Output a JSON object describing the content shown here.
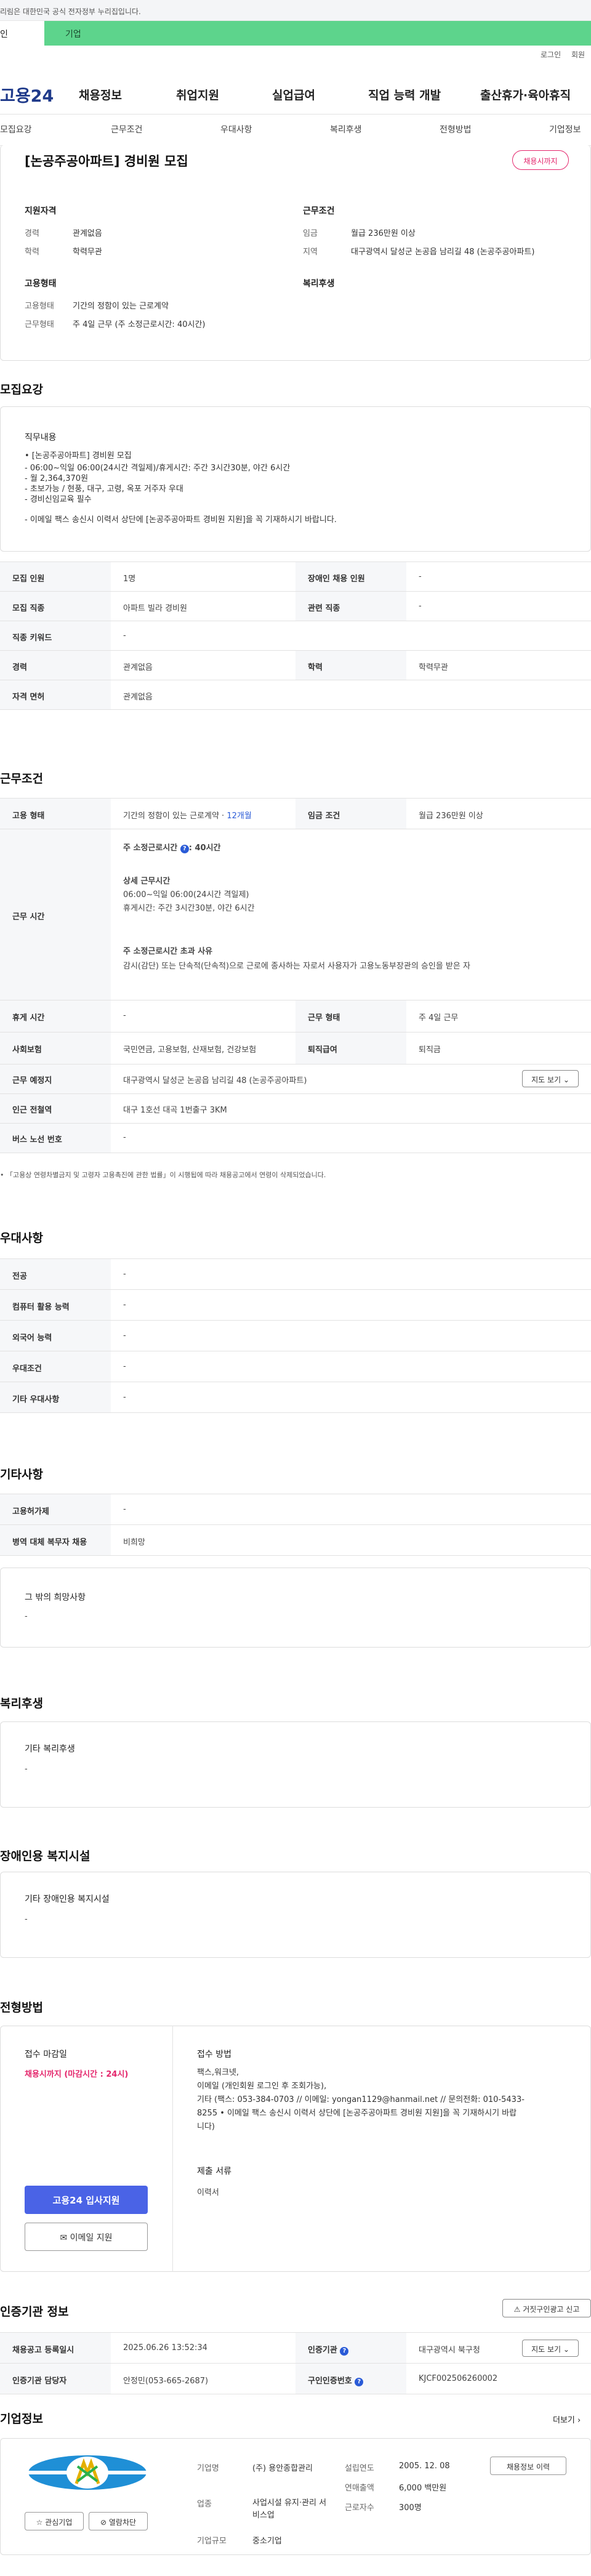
{
  "topnote": "리림은 대한민국 공식 전자정부 누리집입니다.",
  "tabs": {
    "individual": "인",
    "company": "기업"
  },
  "util": {
    "login": "로그인",
    "join": "회원"
  },
  "logo": "고용24",
  "gnb": [
    "채용정보",
    "취업지원",
    "실업급여",
    "직업 능력 개발",
    "출산휴가·육아휴직"
  ],
  "subnav": [
    "모집요강",
    "근무조건",
    "우대사항",
    "복리후생",
    "전형방법",
    "기업정보"
  ],
  "job_title": "[논공주공아파트] 경비원 모집",
  "status_pill": "채용시까지",
  "summary": {
    "qual_title": "지원자격",
    "qual": [
      {
        "k": "경력",
        "v": "관계없음"
      },
      {
        "k": "학력",
        "v": "학력무관"
      }
    ],
    "cond_title": "근무조건",
    "cond": [
      {
        "k": "임금",
        "v": "월급 236만원 이상"
      },
      {
        "k": "지역",
        "v": "대구광역시 달성군 논공읍 남리길 48 (논공주공아파트)"
      }
    ],
    "emp_title": "고용형태",
    "emp": [
      {
        "k": "고용형태",
        "v": "기간의 정함이 있는 근로계약"
      },
      {
        "k": "근무형태",
        "v": "주 4일 근무 (주 소정근로시간: 40시간)"
      }
    ],
    "welfare_title": "복리후생"
  },
  "recruit": {
    "section": "모집요강",
    "duty_title": "직무내용",
    "duty_lines": [
      "• [논공주공아파트] 경비원 모집",
      "- 06:00~익일 06:00(24시간 격일제)/휴게시간: 주간 3시간30분, 야간 6시간",
      "- 월 2,364,370원",
      "- 초보가능 / 현풍, 대구, 고령, 옥포 거주자 우대",
      "- 경비신임교육 필수",
      "",
      "- 이메일 팩스 송신시 이력서 상단에 [논공주공아파트 경비원 지원]을 꼭 기재하시기 바랍니다."
    ],
    "rows": [
      {
        "k1": "모집 인원",
        "v1": "1명",
        "k2": "장애인 채용 인원",
        "v2": "-"
      },
      {
        "k1": "모집 직종",
        "v1": "아파트 빌라 경비원",
        "k2": "관련 직종",
        "v2": "-"
      },
      {
        "k1": "직종 키워드",
        "v1": "-",
        "k2": "",
        "v2": ""
      },
      {
        "k1": "경력",
        "v1": "관계없음",
        "k2": "학력",
        "v2": "학력무관"
      },
      {
        "k1": "자격 면허",
        "v1": "관계없음",
        "k2": "",
        "v2": ""
      }
    ]
  },
  "work": {
    "section": "근무조건",
    "type_k": "고용 형태",
    "type_v": "기간의 정함이 있는 근로계약",
    "type_months": "12개월",
    "wage_k": "임금 조건",
    "wage_v": "월급 236만원 이상",
    "time_k": "근무 시간",
    "weekly": "주 소정근로시간",
    "weekly_v": ": 40시간",
    "detail_title": "상세 근무시간",
    "detail1": "06:00~익일 06:00(24시간 격일제)",
    "detail2": "휴게시간: 주간 3시간30분, 야간 6시간",
    "over_title": "주 소정근로시간 초과 사유",
    "over_text": "감시(감단) 또는 단속적(단속적)으로 근로에 종사하는 자로서 사용자가 고용노동부장관의 승인을 받은 자",
    "rest_k": "휴게 시간",
    "rest_v": "-",
    "form_k": "근무 형태",
    "form_v": "주 4일 근무",
    "ins_k": "사회보험",
    "ins_v": "국민연금, 고용보험, 산재보험, 건강보험",
    "sev_k": "퇴직급여",
    "sev_v": "퇴직금",
    "place_k": "근무 예정지",
    "place_v": "대구광역시 달성군 논공읍 남리길 48 (논공주공아파트)",
    "map_btn": "지도 보기",
    "sub_k": "인근 전철역",
    "sub_v": "대구 1호선 대곡 1번출구 3KM",
    "bus_k": "버스 노선 번호",
    "bus_v": "-",
    "note": "• 「고용상 연령차별금지 및 고령자 고용촉진에 관한 법률」이 시행됩에 따라 채용공고에서 연령이 삭제되었습니다."
  },
  "pref": {
    "section": "우대사항",
    "rows": [
      {
        "k": "전공",
        "v": "-"
      },
      {
        "k": "컴퓨터 활용 능력",
        "v": "-"
      },
      {
        "k": "외국어 능력",
        "v": "-"
      },
      {
        "k": "우대조건",
        "v": "-"
      },
      {
        "k": "기타 우대사항",
        "v": "-"
      }
    ]
  },
  "etc": {
    "section": "기타사항",
    "rows": [
      {
        "k": "고용허가제",
        "v": "-"
      },
      {
        "k": "병역 대체 복무자 채용",
        "v": "비희망"
      }
    ],
    "other_title": "그 밖의 희망사항",
    "other_v": "-"
  },
  "welfare": {
    "section": "복리후생",
    "title": "기타 복리후생",
    "v": "-"
  },
  "disabled": {
    "section": "장애인용 복지시설",
    "title": "기타 장애인용 복지시설",
    "v": "-"
  },
  "apply": {
    "section": "전형방법",
    "deadline_title": "접수 마감일",
    "deadline_v": "채용시까지 (마감시간 : 24시)",
    "method_title": "접수 방법",
    "methods": [
      "팩스,워크넷,",
      "이메일 (개인회원 로그인 후 조회가능),",
      "기타 (팩스: 053-384-0703 // 이메일: yongan1129@hanmail.net // 문의전화: 010-5433-",
      "8255 • 이메일 팩스 송신시 이력서 상단에 [논공주공아파트 경비원 지원]을 꼭 기재하시기 바랍",
      "니다)"
    ],
    "docs_title": "제출 서류",
    "docs_v": "이력서",
    "apply_btn": "고용24 입사지원",
    "email_btn": "이메일 지원"
  },
  "cert": {
    "section": "인증기관 정보",
    "report_btn": "거짓구인광고 신고",
    "reg_k": "채용공고 등록일시",
    "reg_v": "2025.06.26 13:52:34",
    "org_k": "인증기관",
    "org_v": "대구광역시 북구청",
    "map_btn": "지도 보기",
    "mgr_k": "인증기관 담당자",
    "mgr_v": "안정민(053-665-2687)",
    "num_k": "구인인증번호",
    "num_v": "KJCF002506260002"
  },
  "company": {
    "section": "기업정보",
    "more": "더보기",
    "fav_btn": "관심기업",
    "block_btn": "열람차단",
    "name_k": "기업명",
    "name_v": "(주) 용안종합관리",
    "est_k": "설립연도",
    "est_v": "2005. 12. 08",
    "rev_k": "연매출액",
    "rev_v": "6,000 백만원",
    "ind_k": "업종",
    "ind_v": "사업시설 유지·관리 서비스업",
    "emp_k": "근로자수",
    "emp_v": "300명",
    "size_k": "기업규모",
    "size_v": "중소기업",
    "other_jobs": "채용정보 이력"
  },
  "colors": {
    "brand": "#1f3a8a",
    "accent": "#e4266c",
    "green": "#5dd48c",
    "button": "#4a63e6"
  }
}
